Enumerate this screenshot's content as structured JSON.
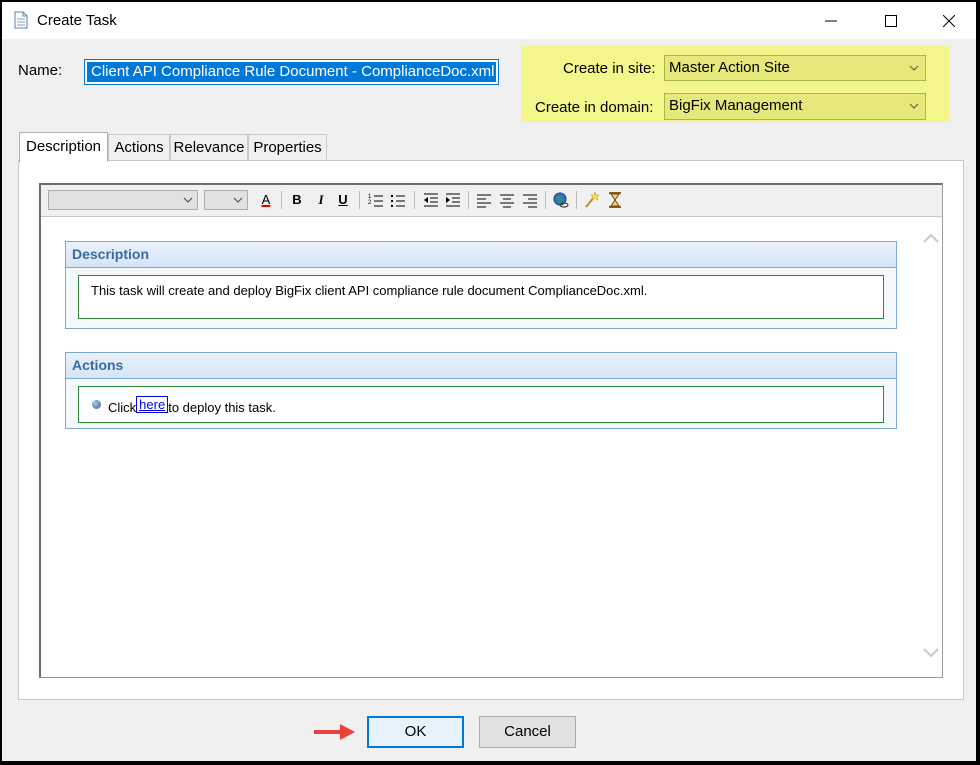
{
  "window": {
    "title": "Create Task",
    "icon": "document-icon"
  },
  "form": {
    "name_label": "Name:",
    "name_value": "Client API Compliance Rule Document - ComplianceDoc.xml",
    "site_label": "Create in site:",
    "site_value": "Master Action Site",
    "domain_label": "Create in domain:",
    "domain_value": "BigFix Management",
    "highlight_color": "#f4f58a"
  },
  "tabs": [
    {
      "label": "Description",
      "active": true
    },
    {
      "label": "Actions"
    },
    {
      "label": "Relevance"
    },
    {
      "label": "Properties"
    }
  ],
  "editor": {
    "toolbar_icons": [
      "font-color-icon",
      "bold-icon",
      "italic-icon",
      "underline-icon",
      "numbered-list-icon",
      "bullet-list-icon",
      "outdent-icon",
      "indent-icon",
      "align-left-icon",
      "align-center-icon",
      "align-right-icon",
      "link-globe-icon",
      "highlight-wand-icon",
      "hourglass-icon"
    ],
    "toolbar_glyphs": {
      "bold": "B",
      "italic": "I",
      "underline": "U",
      "font_color": "A"
    },
    "description": {
      "header": "Description",
      "text": "This task will create and deploy BigFix client API compliance rule document ComplianceDoc.xml."
    },
    "actions": {
      "header": "Actions",
      "prefix": "Click",
      "link": "here",
      "suffix": "to deploy this task."
    }
  },
  "buttons": {
    "ok": "OK",
    "cancel": "Cancel"
  },
  "colors": {
    "accent": "#0078d7",
    "arrow": "#e8423b",
    "section_header": "#3b6aa0",
    "border_green": "#2c8a3c"
  }
}
